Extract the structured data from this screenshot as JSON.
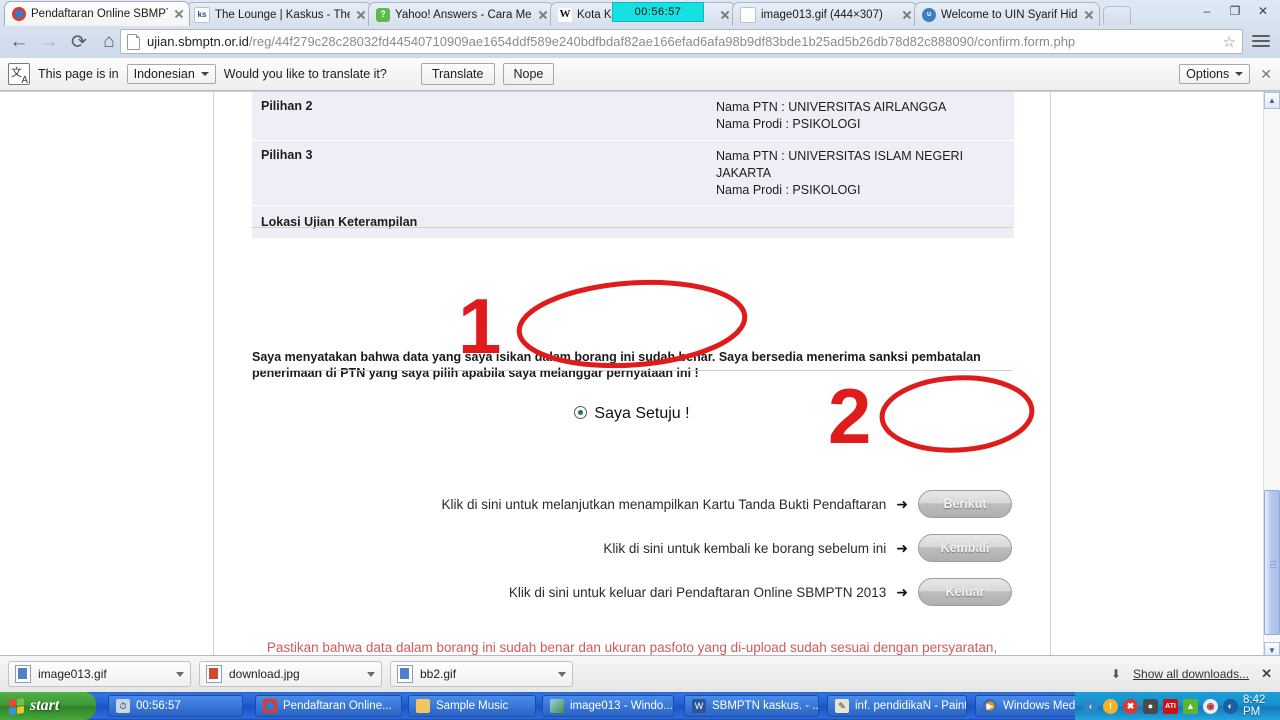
{
  "browser": {
    "tabs": [
      {
        "label": "Pendaftaran Online SBMPTN",
        "icon": "chrome-globe-icon",
        "active": true
      },
      {
        "label": "The Lounge | Kaskus - The L",
        "icon": "kaskus-icon",
        "active": false
      },
      {
        "label": "Yahoo! Answers - Cara Mem",
        "icon": "yahoo-icon",
        "active": false
      },
      {
        "label": "Kota Klaten - W",
        "icon": "wikipedia-icon",
        "active": false
      },
      {
        "label": "image013.gif (444×307)",
        "icon": "image-file-icon",
        "active": false
      },
      {
        "label": "Welcome to UIN Syarif Hiday",
        "icon": "uin-icon",
        "active": false
      }
    ],
    "timer_overlay": "00:56:57",
    "window_controls": {
      "minimize": "–",
      "maximize": "❐",
      "close": "✕"
    },
    "nav": {
      "back": "←",
      "forward": "→",
      "reload": "C",
      "home": "⌂"
    },
    "url": {
      "host": "ujian.sbmptn.or.id",
      "path": "/reg/44f279c28c28032fd44540710909ae1654ddf589e240bdfbdaf82ae166efad6afa98b9df83bde1b25ad5b26db78d82c888090/confirm.form.php",
      "full": "ujian.sbmptn.or.id/reg/44f279c28c28032fd44540710909ae1654ddf589e240bdfbdaf82ae166efad6afa98b9df83bde1b25ad5b26db78d82c888090/confirm.form.php"
    },
    "star": "☆"
  },
  "infobar": {
    "prefix": "This page is in",
    "language": "Indonesian",
    "question": "Would you like to translate it?",
    "translate_label": "Translate",
    "nope_label": "Nope",
    "options_label": "Options",
    "close_label": "✕"
  },
  "form": {
    "table_rows": [
      {
        "label": "Pilihan 2",
        "lines": [
          "Nama PTN : UNIVERSITAS AIRLANGGA",
          "Nama Prodi : PSIKOLOGI"
        ]
      },
      {
        "label": "Pilihan 3",
        "lines": [
          "Nama PTN : UNIVERSITAS ISLAM NEGERI JAKARTA",
          "Nama Prodi : PSIKOLOGI"
        ]
      },
      {
        "label": "Lokasi Ujian Keterampilan",
        "lines": []
      }
    ],
    "declaration": "Saya menyatakan bahwa data yang saya isikan dalam borang ini sudah benar. Saya bersedia menerima sanksi pembatalan penerimaan di PTN yang saya pilih apabila saya melanggar pernyataan ini !",
    "agree_label": "Saya Setuju !",
    "actions": [
      {
        "text": "Klik di sini untuk melanjutkan menampilkan Kartu Tanda Bukti Pendaftaran",
        "arrow": "➜",
        "button": "Berikut"
      },
      {
        "text": "Klik di sini untuk kembali ke borang sebelum ini",
        "arrow": "➜",
        "button": "Kembali"
      },
      {
        "text": "Klik di sini untuk keluar dari Pendaftaran Online SBMPTN 2013",
        "arrow": "➜",
        "button": "Keluar"
      }
    ],
    "warning": "Pastikan bahwa data dalam borang ini sudah benar dan ukuran pasfoto yang di-upload sudah sesuai dengan persyaratan, sebelum melanjutkan ke proses berikutnya !"
  },
  "annotations": {
    "marker_one": "1",
    "marker_two": "2",
    "color": "#e01b1b"
  },
  "downloads": {
    "items": [
      {
        "name": "image013.gif",
        "type": "gif"
      },
      {
        "name": "download.jpg",
        "type": "jpg"
      },
      {
        "name": "bb2.gif",
        "type": "gif"
      }
    ],
    "show_all_label": "Show all downloads...",
    "close_label": "✕"
  },
  "taskbar": {
    "start_label": "start",
    "items": [
      {
        "label": "00:56:57",
        "icon": "timer-icon"
      },
      {
        "label": "Pendaftaran Online...",
        "icon": "chrome-icon"
      },
      {
        "label": "Sample Music",
        "icon": "folder-icon"
      },
      {
        "label": "image013 - Windo...",
        "icon": "photo-viewer-icon"
      },
      {
        "label": "SBMPTN kaskus. - ...",
        "icon": "word-doc-icon"
      },
      {
        "label": "inf. pendidikaN - Paint",
        "icon": "paint-icon"
      },
      {
        "label": "Windows Media Pla...",
        "icon": "wmp-icon"
      }
    ],
    "tray_icons": [
      "show-hidden-icon",
      "security-shield-icon",
      "antivirus-icon",
      "pcsafety-icon",
      "ati-icon",
      "nvidia-icon",
      "monitor-icon",
      "connection-icon"
    ],
    "clock": "8:42 PM"
  }
}
